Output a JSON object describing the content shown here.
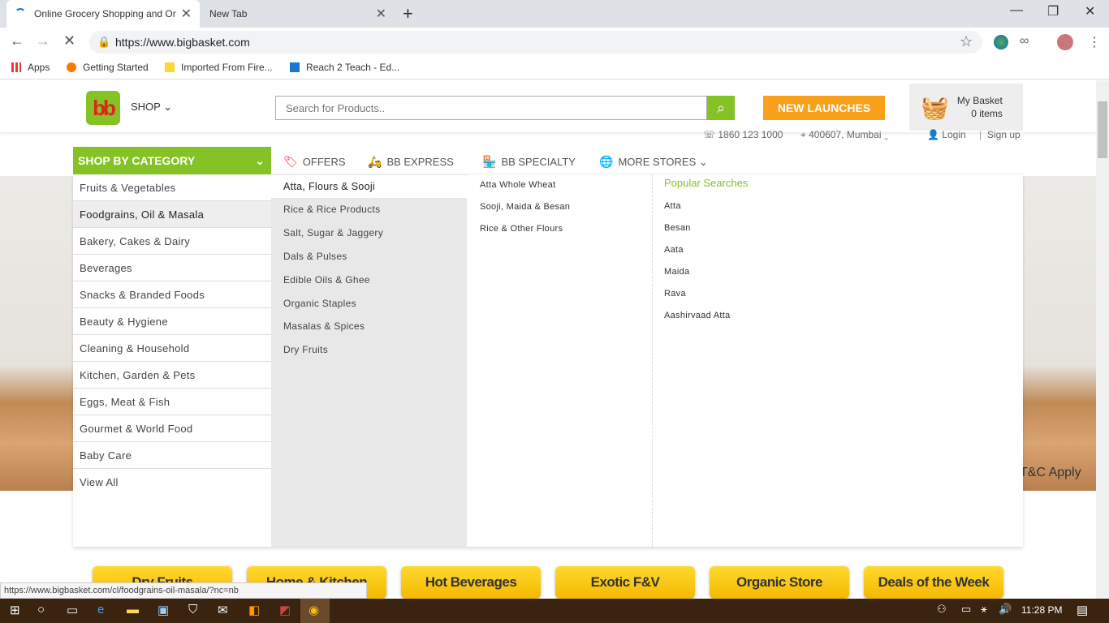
{
  "browser": {
    "tabs": [
      {
        "title": "Online Grocery Shopping and Or",
        "close": "✕"
      },
      {
        "title": "New Tab",
        "close": "✕"
      }
    ],
    "new_tab": "+",
    "window_controls": {
      "minimize": "—",
      "maximize": "❐",
      "close": "✕"
    },
    "url": "https://www.bigbasket.com",
    "bookmarks": [
      "Apps",
      "Getting Started",
      "Imported From Fire...",
      "Reach 2 Teach - Ed..."
    ],
    "status_url": "https://www.bigbasket.com/cl/foodgrains-oil-masala/?nc=nb"
  },
  "header": {
    "logo": "bb",
    "shop": "SHOP",
    "search_placeholder": "Search for Products..",
    "new_launches": "NEW LAUNCHES",
    "basket_title": "My Basket",
    "basket_count": "0 items",
    "phone": "1860 123 1000",
    "location": "400607, Mumbai",
    "login": "Login",
    "signup": "Sign up"
  },
  "nav": {
    "shop_by_category": "SHOP BY CATEGORY",
    "offers": "OFFERS",
    "bb_express": "BB EXPRESS",
    "bb_specialty": "BB SPECIALTY",
    "more_stores": "MORE STORES"
  },
  "categories": [
    "Fruits & Vegetables",
    "Foodgrains, Oil & Masala",
    "Bakery, Cakes & Dairy",
    "Beverages",
    "Snacks & Branded Foods",
    "Beauty & Hygiene",
    "Cleaning & Household",
    "Kitchen, Garden & Pets",
    "Eggs, Meat & Fish",
    "Gourmet & World Food",
    "Baby Care",
    "View All"
  ],
  "subcategories": [
    "Atta, Flours & Sooji",
    "Rice & Rice Products",
    "Salt, Sugar & Jaggery",
    "Dals & Pulses",
    "Edible Oils & Ghee",
    "Organic Staples",
    "Masalas & Spices",
    "Dry Fruits"
  ],
  "sub_subcategories": [
    "Atta Whole Wheat",
    "Sooji, Maida & Besan",
    "Rice & Other Flours"
  ],
  "popular_searches": {
    "title": "Popular Searches",
    "items": [
      "Atta",
      "Besan",
      "Aata",
      "Maida",
      "Rava",
      "Aashirvaad Atta"
    ]
  },
  "hero_tc": "T&C Apply",
  "promos": [
    "Dry Fruits",
    "Home & Kitchen",
    "Hot Beverages",
    "Exotic F&V",
    "Organic Store",
    "Deals of the Week"
  ],
  "taskbar": {
    "time": "11:28 PM"
  }
}
